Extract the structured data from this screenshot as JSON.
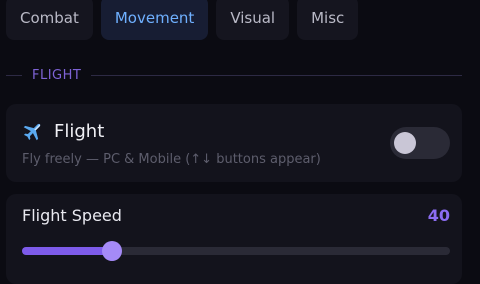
{
  "tabs": [
    {
      "label": "Combat",
      "active": false
    },
    {
      "label": "Movement",
      "active": true
    },
    {
      "label": "Visual",
      "active": false
    },
    {
      "label": "Misc",
      "active": false
    }
  ],
  "section": {
    "title": "FLIGHT"
  },
  "flight": {
    "icon": "airplane-icon",
    "title": "Flight",
    "description": "Fly freely — PC & Mobile (↑↓ buttons appear)",
    "enabled": false
  },
  "speed": {
    "label": "Flight Speed",
    "value": "40",
    "fraction": 0.21
  },
  "colors": {
    "accent": "#7d5bea",
    "active_tab_text": "#6fb0ff",
    "section_title": "#7e63d6",
    "background": "#0b0b12",
    "card": "#13131c"
  }
}
